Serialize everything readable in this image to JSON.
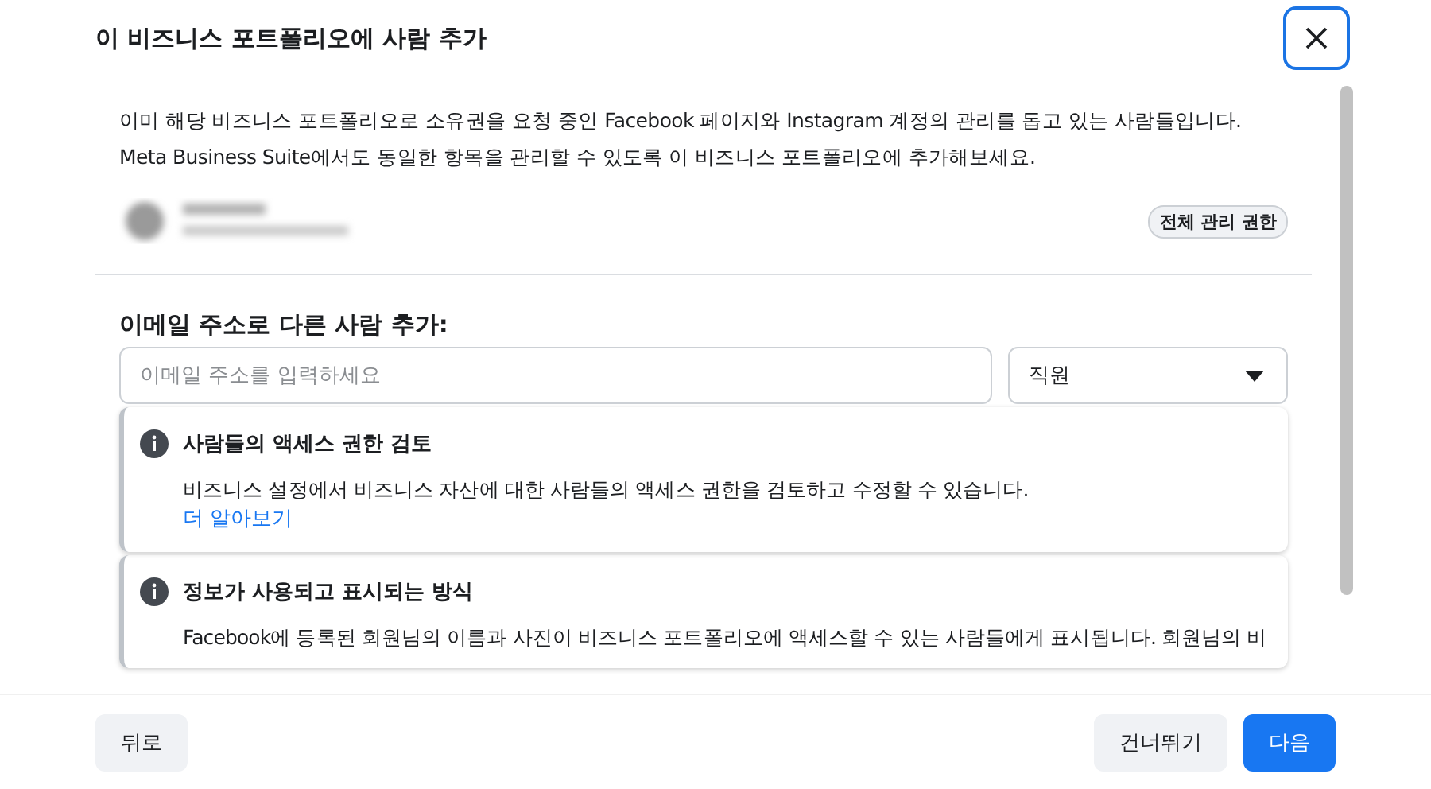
{
  "dialog": {
    "title": "이 비즈니스 포트폴리오에 사람 추가"
  },
  "intro": "이미 해당 비즈니스 포트폴리오로 소유권을 요청 중인 Facebook 페이지와 Instagram 계정의 관리를 돕고 있는 사람들입니다. Meta Business Suite에서도 동일한 항목을 관리할 수 있도록 이 비즈니스 포트폴리오에 추가해보세요.",
  "person": {
    "badge": "전체 관리 권한"
  },
  "add_section": {
    "heading": "이메일 주소로 다른 사람 추가:",
    "email_field": {
      "placeholder": "이메일 주소를 입력하세요"
    },
    "role_select": {
      "value": "직원"
    }
  },
  "notices": [
    {
      "title": "사람들의 액세스 권한 검토",
      "body": "비즈니스 설정에서 비즈니스 자산에 대한 사람들의 액세스 권한을 검토하고 수정할 수 있습니다.",
      "link": "더 알아보기"
    },
    {
      "title": "정보가 사용되고 표시되는 방식",
      "body": "Facebook에 등록된 회원님의 이름과 사진이 비즈니스 포트폴리오에 액세스할 수 있는 사람들에게 표시됩니다. 회원님의 비"
    }
  ],
  "footer": {
    "back": "뒤로",
    "skip": "건너뛰기",
    "next": "다음"
  }
}
